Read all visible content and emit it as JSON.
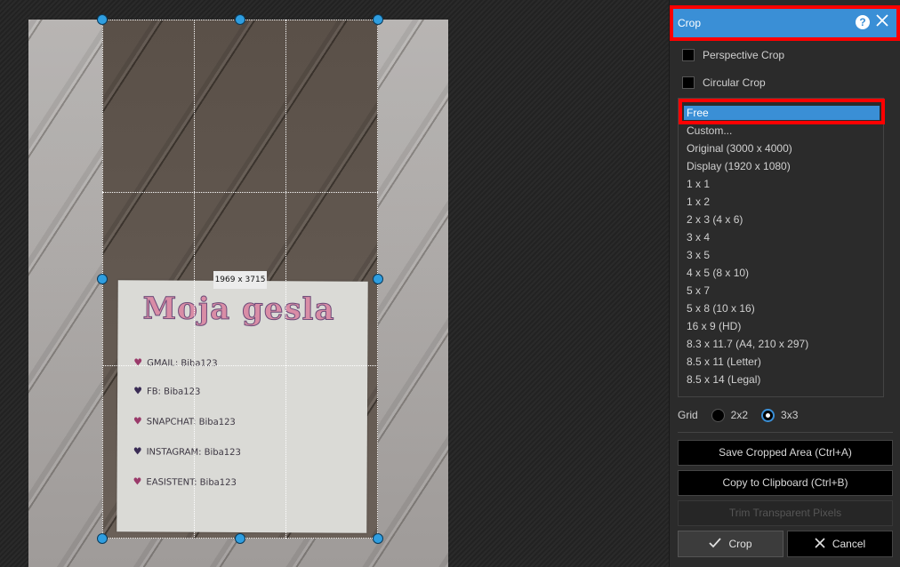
{
  "canvas": {
    "crop_dimensions": "1969 x 3715",
    "paper": {
      "title": "Moja gesla",
      "lines": [
        "GMAIL: Biba123",
        "FB: Biba123",
        "SNAPCHAT: Biba123",
        "INSTAGRAM: Biba123",
        "EASISTENT: Biba123"
      ]
    }
  },
  "panel": {
    "title": "Crop",
    "help_icon": "question-circle-icon",
    "close_icon": "close-x-icon",
    "options": {
      "perspective_crop": "Perspective Crop",
      "circular_crop": "Circular Crop"
    },
    "ratios": [
      "Free",
      "Custom...",
      "Original (3000 x 4000)",
      "Display (1920 x 1080)",
      "1 x 1",
      "1 x 2",
      "2 x 3 (4 x 6)",
      "3 x 4",
      "3 x 5",
      "4 x 5 (8 x 10)",
      "5 x 7",
      "5 x 8 (10 x 16)",
      "16 x 9 (HD)",
      "8.3 x 11.7 (A4, 210 x 297)",
      "8.5 x 11 (Letter)",
      "8.5 x 14 (Legal)"
    ],
    "selected_ratio": "Free",
    "grid": {
      "label": "Grid",
      "option_2x2": "2x2",
      "option_3x3": "3x3",
      "selected": "3x3"
    },
    "buttons": {
      "save_cropped": "Save Cropped Area (Ctrl+A)",
      "copy_clipboard": "Copy to Clipboard (Ctrl+B)",
      "trim_transparent": "Trim Transparent Pixels",
      "crop": "Crop",
      "cancel": "Cancel"
    }
  },
  "colors": {
    "accent": "#3a8fd6",
    "highlight_outline": "#ff0000",
    "handle": "#2f9ee0"
  }
}
